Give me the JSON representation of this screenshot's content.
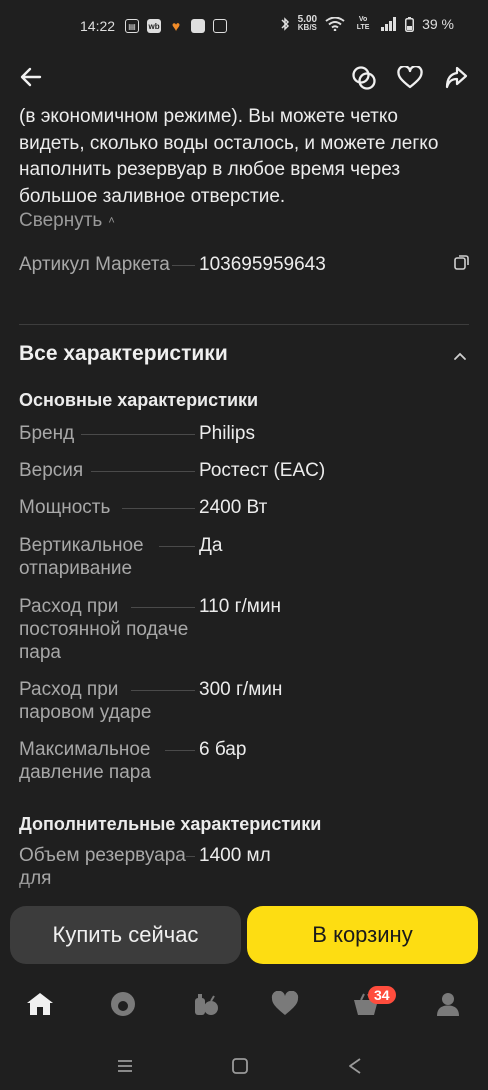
{
  "status_bar": {
    "time": "14:22",
    "notif_icons": [
      "sim-app-icon",
      "wb-icon",
      "heart-app-icon",
      "square-app-icon",
      "calendar-app-icon"
    ],
    "net_speed_value": "5.00",
    "net_speed_unit": "KB/S",
    "volte": "Vo LTE",
    "battery": "39 %"
  },
  "top_bar": {
    "icons": [
      "back-arrow-icon",
      "compare-icon",
      "heart-icon",
      "share-icon"
    ]
  },
  "description": {
    "text": "(в экономичном режиме). Вы можете четко видеть, сколько воды осталось, и можете легко наполнить резервуар в любое время через большое заливное отверстие.",
    "collapse_label": "Свернуть"
  },
  "sku": {
    "name": "Артикул Маркета",
    "value": "103695959643"
  },
  "all_specs": {
    "title": "Все характеристики",
    "groups": [
      {
        "title": "Основные характеристики",
        "items": [
          {
            "name": "Бренд",
            "value": "Philips"
          },
          {
            "name": "Версия",
            "value": "Ростест (EAC)"
          },
          {
            "name": "Мощность",
            "value": "2400 Вт"
          },
          {
            "name": "Вертикальное отпаривание",
            "value": "Да"
          },
          {
            "name": "Расход при постоянной подаче пара",
            "value": "110 г/мин"
          },
          {
            "name": "Расход при паровом ударе",
            "value": "300 г/мин"
          },
          {
            "name": "Максимальное давление пара",
            "value": "6 бар"
          }
        ]
      },
      {
        "title": "Дополнительные характеристики",
        "items": [
          {
            "name": "Объем резервуара для",
            "value": "1400 мл"
          }
        ]
      }
    ]
  },
  "actions": {
    "buy_now": "Купить сейчас",
    "add_to_cart": "В корзину"
  },
  "bottom_nav": {
    "items": [
      "home-icon",
      "alice-icon",
      "catalog-icon",
      "favorites-icon",
      "cart-icon",
      "profile-icon"
    ],
    "cart_badge": "34"
  },
  "colors": {
    "background": "#1f1f1f",
    "primary_button": "#fddd12",
    "secondary_button": "#3c3c3c",
    "badge": "#ff4d3d",
    "muted_text": "#a8a8a8"
  }
}
